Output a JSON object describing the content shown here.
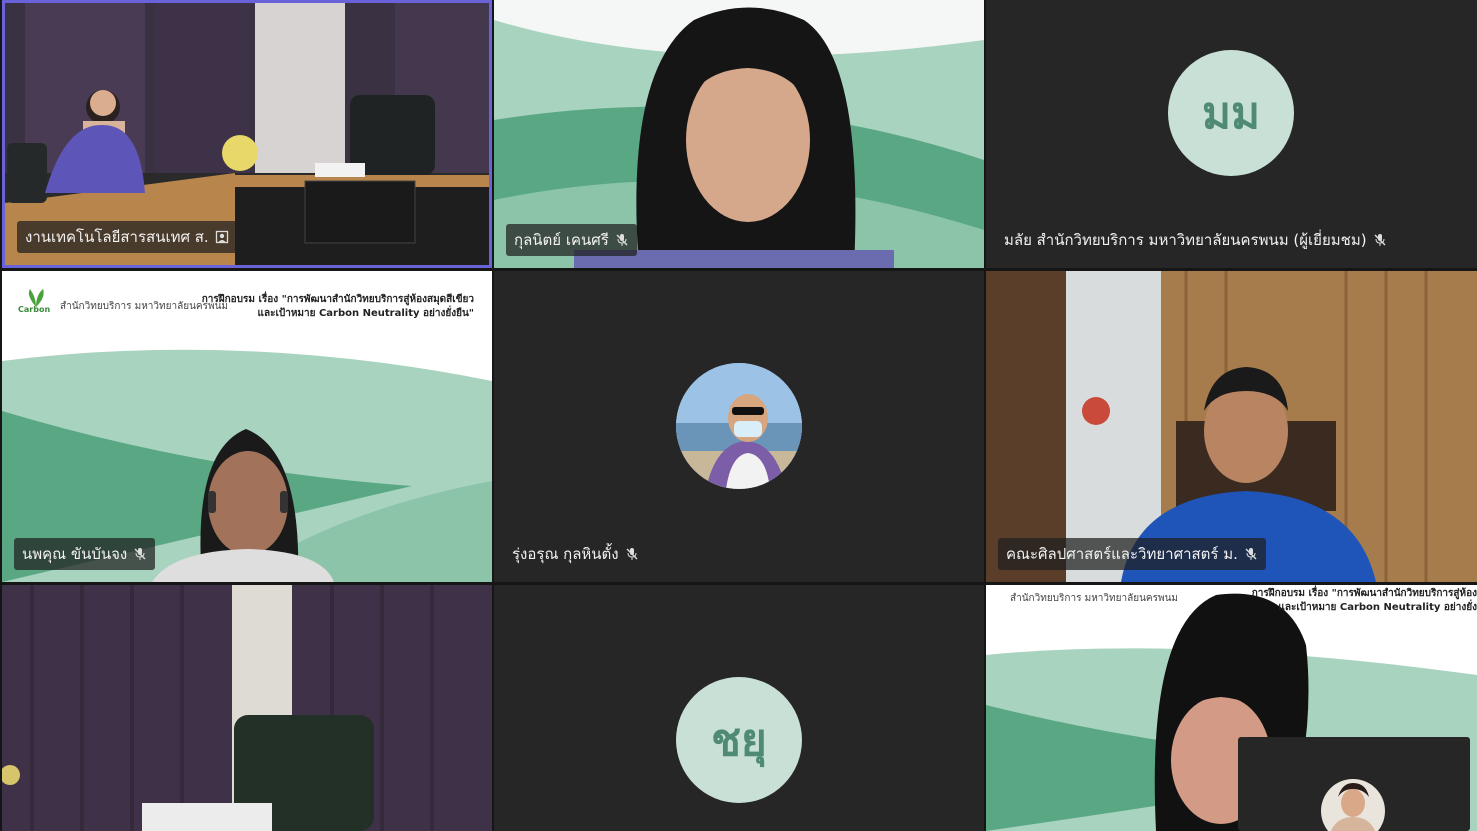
{
  "participants": [
    {
      "name": "งานเทคโนโลยีสารสนเทศ ส.",
      "status_icon": "host-icon",
      "active_speaker": true
    },
    {
      "name": "กุลนิตย์  เคนศรี",
      "status_icon": "mic-muted-icon"
    },
    {
      "name": "มลัย สำนักวิทยบริการ มหาวิทยาลัยนครพนม (ผู้เยี่ยมชม)",
      "status_icon": "mic-muted-icon",
      "initials": "มม"
    },
    {
      "name": "นพคุณ  ขันบันจง",
      "status_icon": "mic-muted-icon"
    },
    {
      "name": "รุ่งอรุณ   กุลหินตั้ง",
      "status_icon": "mic-muted-icon"
    },
    {
      "name": "คณะศิลปศาสตร์และวิทยาศาสตร์ ม.",
      "status_icon": "mic-muted-icon"
    },
    {
      "name": "",
      "status_icon": ""
    },
    {
      "name": "",
      "initials": "ชยุ"
    },
    {
      "name": ""
    }
  ],
  "slide": {
    "org": "สำนักวิทยบริการ มหาวิทยาลัยนครพนม",
    "title_line1": "การฝึกอบรม เรื่อง \"การพัฒนาสำนักวิทยบริการสู่ห้องสมุดสีเขียว",
    "title_line2": "และเป้าหมาย Carbon Neutrality อย่างยั่งยืน\"",
    "logo_text": "Carbon",
    "title_line1_b": "การฝึกอบรม เรื่อง \"การพัฒนาสำนักวิทยบริการสู่ห้อง",
    "title_line2_b": "และเป้าหมาย Carbon Neutrality อย่างยั่ง"
  },
  "colors": {
    "background": "#161616",
    "tile": "#262626",
    "active_border": "#6a62d8",
    "avatar_bg": "#c8e0d6",
    "avatar_text": "#4e8a74",
    "slide_green_dark": "#5aa784",
    "slide_green_light": "#a8d3bf"
  }
}
